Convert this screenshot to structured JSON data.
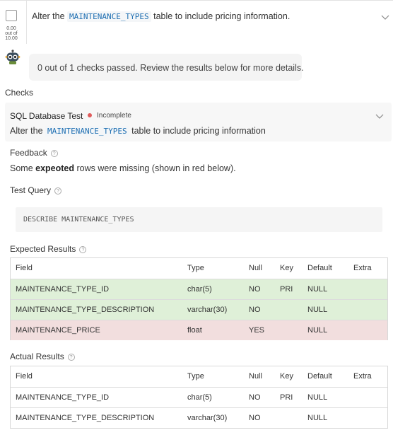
{
  "task": {
    "score_value": "0.00",
    "score_mid": "out of",
    "score_max": "10.00",
    "text_before": "Alter the",
    "text_code": "MAINTENANCE_TYPES",
    "text_after": "table to include pricing information."
  },
  "bot": {
    "message": "0 out of 1 checks passed. Review the results below for more details."
  },
  "checks": {
    "heading": "Checks",
    "test": {
      "name": "SQL Database Test",
      "status": "Incomplete",
      "status_color": "#e05c5c",
      "desc_before": "Alter the",
      "desc_code": "MAINTENANCE_TYPES",
      "desc_after": "table to include pricing information"
    },
    "feedback_label": "Feedback",
    "feedback_before": "Some",
    "feedback_bold": "expeoted",
    "feedback_after": "rows were missing (shown in red below).",
    "query_label": "Test Query",
    "query": "DESCRIBE MAINTENANCE_TYPES",
    "expected_label": "Expected Results",
    "actual_label": "Actual Results",
    "columns": [
      "Field",
      "Type",
      "Null",
      "Key",
      "Default",
      "Extra"
    ],
    "expected_rows": [
      {
        "field": "MAINTENANCE_TYPE_ID",
        "type": "char(5)",
        "null": "NO",
        "key": "PRI",
        "default": "NULL",
        "extra": "",
        "state": "match"
      },
      {
        "field": "MAINTENANCE_TYPE_DESCRIPTION",
        "type": "varchar(30)",
        "null": "NO",
        "key": "",
        "default": "NULL",
        "extra": "",
        "state": "match"
      },
      {
        "field": "MAINTENANCE_PRICE",
        "type": "float",
        "null": "YES",
        "key": "",
        "default": "NULL",
        "extra": "",
        "state": "missing"
      }
    ],
    "actual_rows": [
      {
        "field": "MAINTENANCE_TYPE_ID",
        "type": "char(5)",
        "null": "NO",
        "key": "PRI",
        "default": "NULL",
        "extra": ""
      },
      {
        "field": "MAINTENANCE_TYPE_DESCRIPTION",
        "type": "varchar(30)",
        "null": "NO",
        "key": "",
        "default": "NULL",
        "extra": ""
      }
    ]
  },
  "colors": {
    "match_row": "#dff0d8",
    "missing_row": "#f2dede",
    "code_text": "#1f6fb2"
  }
}
